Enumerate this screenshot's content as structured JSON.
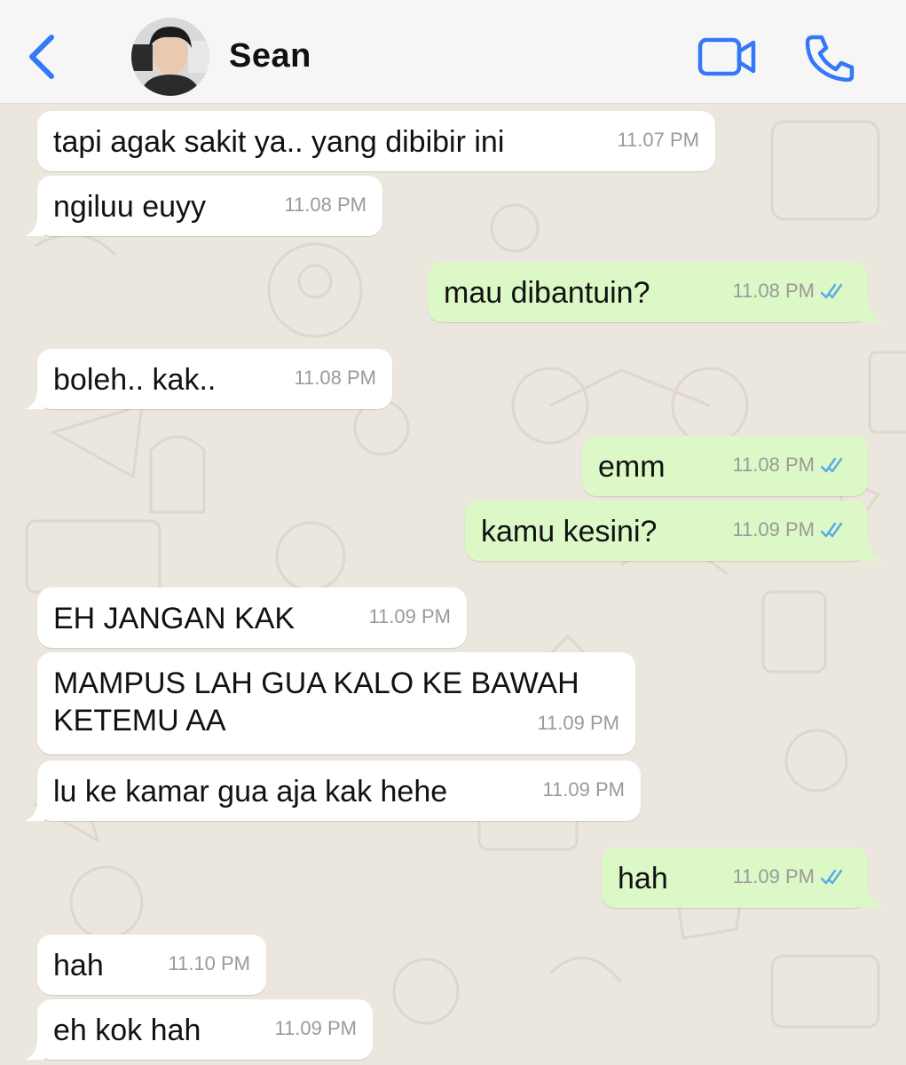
{
  "header": {
    "contact_name": "Sean",
    "back_icon": "chevron-left-icon",
    "video_icon": "video-camera-icon",
    "call_icon": "phone-icon",
    "accent_color": "#3478f6"
  },
  "colors": {
    "incoming_bubble": "#ffffff",
    "outgoing_bubble": "#dcf8c6",
    "read_ticks": "#5aa9e6",
    "timestamp": "#9a9a9a",
    "chat_background": "#ebe6de"
  },
  "messages": [
    {
      "direction": "in",
      "text": "tapi agak sakit ya.. yang dibibir ini",
      "time": "11.07 PM"
    },
    {
      "direction": "in",
      "text": "ngiluu euyy",
      "time": "11.08 PM"
    },
    {
      "direction": "out",
      "text": "mau dibantuin?",
      "time": "11.08 PM",
      "status": "read"
    },
    {
      "direction": "in",
      "text": "boleh.. kak..",
      "time": "11.08 PM"
    },
    {
      "direction": "out",
      "text": "emm",
      "time": "11.08 PM",
      "status": "read"
    },
    {
      "direction": "out",
      "text": "kamu kesini?",
      "time": "11.09 PM",
      "status": "read"
    },
    {
      "direction": "in",
      "text": "EH JANGAN KAK",
      "time": "11.09 PM"
    },
    {
      "direction": "in",
      "text": "MAMPUS LAH GUA KALO KE BAWAH\nKETEMU AA",
      "time": "11.09 PM"
    },
    {
      "direction": "in",
      "text": "lu ke kamar gua aja kak hehe",
      "time": "11.09 PM"
    },
    {
      "direction": "out",
      "text": "hah",
      "time": "11.09 PM",
      "status": "read"
    },
    {
      "direction": "in",
      "text": "hah",
      "time": "11.10 PM"
    },
    {
      "direction": "in",
      "text": "eh kok hah",
      "time": "11.09 PM"
    }
  ]
}
